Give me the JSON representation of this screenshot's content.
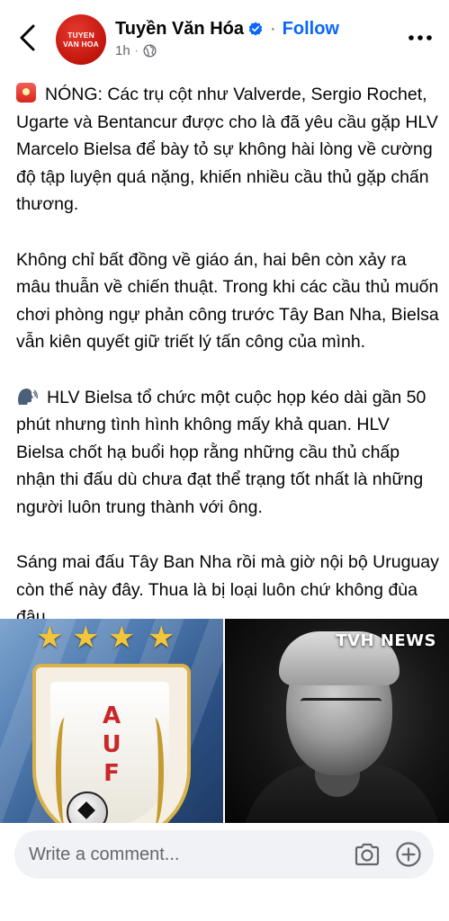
{
  "post": {
    "author": "Tuyền Văn Hóa",
    "follow_label": "Follow",
    "separator": "·",
    "time": "1h",
    "avatar_text": {
      "line1": "TUYEN",
      "line2": "VAN HOA"
    },
    "paragraphs": [
      "NÓNG: Các trụ cột như Valverde, Sergio Rochet, Ugarte và Bentancur được cho là đã yêu cầu gặp HLV Marcelo Bielsa để bày tỏ sự không hài lòng về cường độ tập luyện quá nặng, khiến nhiều cầu thủ gặp chấn thương.",
      "Không chỉ bất đồng về giáo án, hai bên còn xảy ra mâu thuẫn về chiến thuật. Trong khi các cầu thủ muốn chơi phòng ngự phản công trước Tây Ban Nha, Bielsa vẫn kiên quyết giữ triết lý tấn công của mình.",
      "HLV Bielsa tổ chức một cuộc họp kéo dài gần 50 phút nhưng tình hình không mấy khả quan. HLV Bielsa chốt hạ buổi họp rằng những cầu thủ chấp nhận thi đấu dù chưa đạt thể trạng tốt nhất là những người luôn trung thành với ông.",
      "Sáng mai đấu Tây Ban Nha rồi mà giờ nội bộ Uruguay còn thế này đây. Thua là bị loại luôn chứ không đùa đâu."
    ],
    "image": {
      "watermark": "TVH NEWS",
      "badge_letters": [
        "A",
        "U",
        "F"
      ]
    }
  },
  "composer": {
    "placeholder": "Write a comment..."
  },
  "icons": {
    "back": "chevron-left-icon",
    "verified": "verified-badge-icon",
    "privacy": "globe-icon",
    "more": "more-dots-icon",
    "camera": "camera-icon",
    "add": "plus-circle-icon"
  },
  "colors": {
    "link_blue": "#0866ff",
    "secondary_text": "#65676b",
    "composer_bg": "#f0f2f5",
    "brand_red": "#c1140c"
  }
}
